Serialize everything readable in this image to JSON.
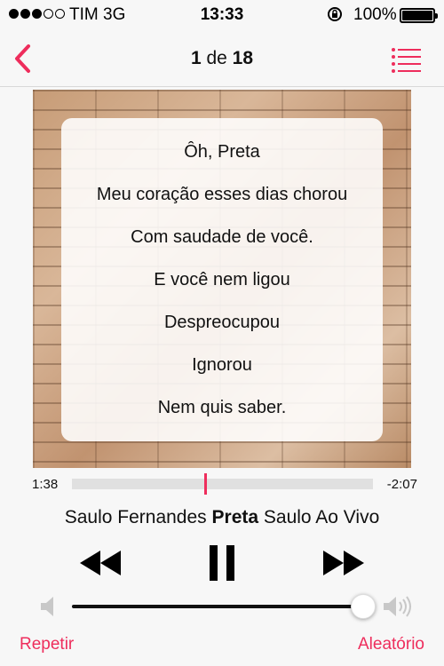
{
  "status_bar": {
    "carrier": "TIM",
    "network": "3G",
    "time": "13:33",
    "battery": "100%",
    "signal_bars_filled": 3,
    "signal_bars_total": 5
  },
  "nav": {
    "track_index": "1",
    "track_separator": " de ",
    "track_total": "18"
  },
  "lyrics": [
    "Ôh, Preta",
    "Meu coração esses dias chorou",
    "Com saudade de você.",
    "E você nem ligou",
    "Despreocupou",
    "Ignorou",
    "Nem quis saber."
  ],
  "playback": {
    "elapsed": "1:38",
    "remaining": "-2:07",
    "progress_fraction": 0.44
  },
  "song": {
    "artist": "Saulo Fernandes",
    "title": "Preta",
    "album": "Saulo Ao Vivo"
  },
  "volume": {
    "level_fraction": 0.98
  },
  "bottom": {
    "repeat_label": "Repetir",
    "shuffle_label": "Aleatório"
  },
  "colors": {
    "accent": "#ee2d5c"
  }
}
